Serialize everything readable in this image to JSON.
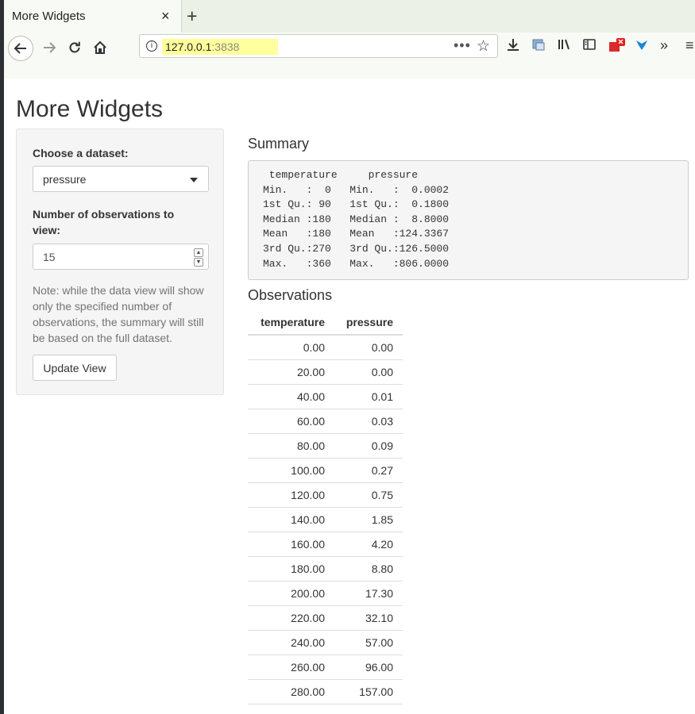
{
  "browser": {
    "tab_title": "More Widgets",
    "tab_close": "×",
    "new_tab": "+",
    "url_host": "127.0.0.1",
    "url_port": ":3838",
    "url_more": "•••",
    "toolbar_overflow": "»"
  },
  "page": {
    "title": "More Widgets"
  },
  "sidebar": {
    "dataset_label": "Choose a dataset:",
    "dataset_value": "pressure",
    "obs_label": "Number of observations to view:",
    "obs_value": "15",
    "note": "Note: while the data view will show only the specified number of observations, the summary will still be based on the full dataset.",
    "update_button": "Update View"
  },
  "summary": {
    "heading": "Summary",
    "lines": [
      " temperature     pressure     ",
      "Min.   :  0   Min.   :  0.0002  ",
      "1st Qu.: 90   1st Qu.:  0.1800  ",
      "Median :180   Median :  8.8000  ",
      "Mean   :180   Mean   :124.3367  ",
      "3rd Qu.:270   3rd Qu.:126.5000  ",
      "Max.   :360   Max.   :806.0000  "
    ]
  },
  "observations": {
    "heading": "Observations",
    "columns": [
      "temperature",
      "pressure"
    ],
    "rows": [
      [
        "0.00",
        "0.00"
      ],
      [
        "20.00",
        "0.00"
      ],
      [
        "40.00",
        "0.01"
      ],
      [
        "60.00",
        "0.03"
      ],
      [
        "80.00",
        "0.09"
      ],
      [
        "100.00",
        "0.27"
      ],
      [
        "120.00",
        "0.75"
      ],
      [
        "140.00",
        "1.85"
      ],
      [
        "160.00",
        "4.20"
      ],
      [
        "180.00",
        "8.80"
      ],
      [
        "200.00",
        "17.30"
      ],
      [
        "220.00",
        "32.10"
      ],
      [
        "240.00",
        "57.00"
      ],
      [
        "260.00",
        "96.00"
      ],
      [
        "280.00",
        "157.00"
      ]
    ]
  }
}
